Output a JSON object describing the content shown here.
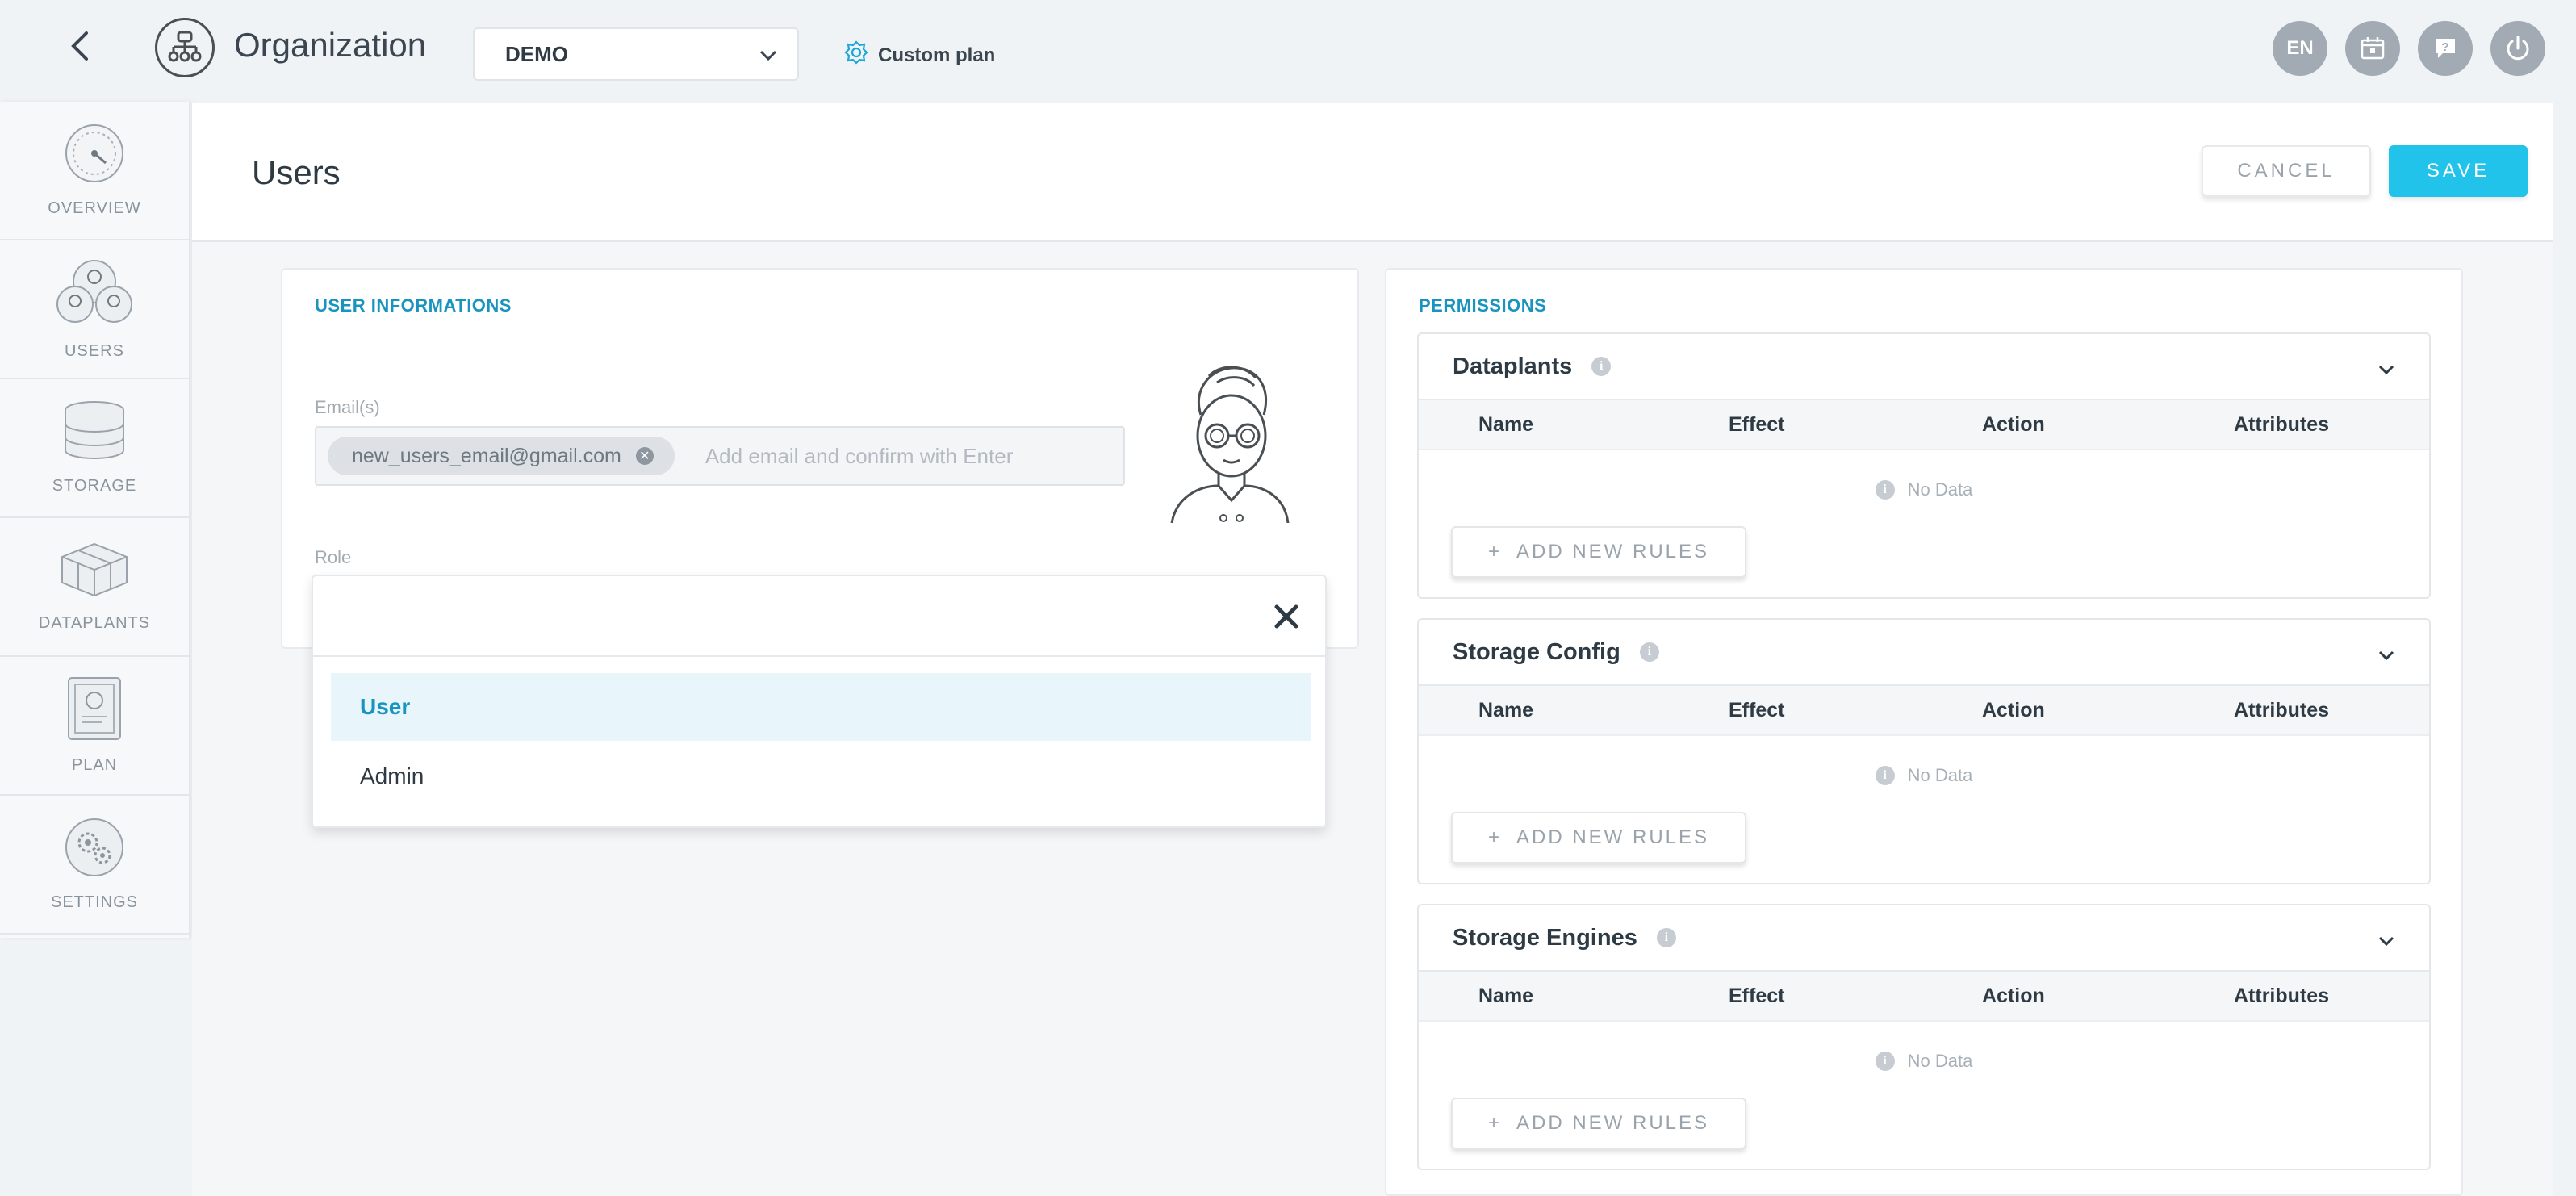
{
  "topbar": {
    "app_title": "Organization",
    "org_select_value": "DEMO",
    "plan_label": "Custom plan",
    "lang_label": "EN"
  },
  "sidebar": {
    "items": [
      {
        "label": "OVERVIEW",
        "icon": "gauge-icon"
      },
      {
        "label": "USERS",
        "icon": "users-icon"
      },
      {
        "label": "STORAGE",
        "icon": "database-icon"
      },
      {
        "label": "DATAPLANTS",
        "icon": "cubes-icon"
      },
      {
        "label": "PLAN",
        "icon": "plan-document-icon"
      },
      {
        "label": "SETTINGS",
        "icon": "gears-icon"
      }
    ]
  },
  "header": {
    "title": "Users",
    "cancel_label": "CANCEL",
    "save_label": "SAVE"
  },
  "user_info": {
    "section_title": "USER INFORMATIONS",
    "email_label": "Email(s)",
    "email_chip": "new_users_email@gmail.com",
    "email_placeholder": "Add email and confirm with Enter",
    "role_label": "Role"
  },
  "role_dropdown": {
    "options": [
      "User",
      "Admin"
    ],
    "selected": "User"
  },
  "permissions": {
    "section_title": "PERMISSIONS",
    "columns": [
      "Name",
      "Effect",
      "Action",
      "Attributes"
    ],
    "no_data": "No Data",
    "add_rules_label": "ADD NEW RULES",
    "groups": [
      {
        "title": "Dataplants"
      },
      {
        "title": "Storage Config"
      },
      {
        "title": "Storage Engines"
      }
    ]
  },
  "colors": {
    "accent": "#22c3ea",
    "section_title": "#1894bf",
    "icon_gray": "#a2abb3"
  }
}
